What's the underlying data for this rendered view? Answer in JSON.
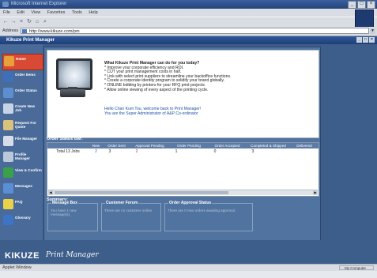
{
  "browser": {
    "title": "Microsoft Internet Explorer",
    "menu": [
      "File",
      "Edit",
      "View",
      "Favorites",
      "Tools",
      "Help"
    ],
    "address_label": "Address",
    "address_value": "http://www.kikuze.com/pm"
  },
  "app": {
    "title": "Kikuze Print Manager",
    "nav": [
      {
        "label": "Home",
        "icon": "home-icon",
        "color": "#e8a13a"
      },
      {
        "label": "Order Items",
        "icon": "order-items-icon",
        "color": "#3f6fb8"
      },
      {
        "label": "Order Status",
        "icon": "order-status-icon",
        "color": "#5c8fd0"
      },
      {
        "label": "Create New Job",
        "icon": "create-job-icon",
        "color": "#c6d4e6"
      },
      {
        "label": "Request For Quote",
        "icon": "quote-icon",
        "color": "#d9c27a"
      },
      {
        "label": "File Manager",
        "icon": "file-manager-icon",
        "color": "#d6dde8"
      },
      {
        "label": "Profile Manager",
        "icon": "profile-manager-icon",
        "color": "#b9c8db"
      },
      {
        "label": "View & Confirm",
        "icon": "view-confirm-icon",
        "color": "#3aa04a"
      },
      {
        "label": "Messages",
        "icon": "messages-icon",
        "color": "#5a8fd8"
      },
      {
        "label": "FAQ",
        "icon": "faq-icon",
        "color": "#e9d24a"
      },
      {
        "label": "Glossary",
        "icon": "glossary-icon",
        "color": "#3c74c6"
      }
    ],
    "welcome": {
      "question": "What Kikuze Print Manager can do for you today?",
      "bullets": [
        "* Improve your corporate efficiency and ROI.",
        "* CUT your print management costs in half.",
        "* Link with select print suppliers to streamline your backoffice functions.",
        "* Create a corporate identity program to solidify your brand globally.",
        "* ONLINE bidding by printers for your RFQ print projects.",
        "* Allow online viewing of every aspect of the printing cycle."
      ],
      "hello": "Hello Chan Kum Tou, welcome back to Print Manager!",
      "role": "You are the Super Administrator of A&P Co-ordinator"
    },
    "order_status": {
      "label": "Order Status Bar:",
      "headers": [
        "",
        "New",
        "Order Sent",
        "Approval Pending",
        "Order Pending",
        "Order Accepted",
        "Completed & Shipped",
        "Delivered"
      ],
      "row": [
        "Total 13 Jobs",
        "2",
        "3",
        "2",
        "1",
        "0",
        "3",
        ""
      ]
    },
    "summary": {
      "label": "Summary:",
      "boxes": [
        {
          "title": "Message Box",
          "text": "You have 1 new message(s)."
        },
        {
          "title": "Customer Forum",
          "text": "There are no customer online."
        },
        {
          "title": "Order Approval Status",
          "text": "There are 0 new orders awaiting approval."
        }
      ]
    },
    "logo_text": "KIKUZE",
    "logo_script": "Print Manager"
  },
  "status_bar": {
    "left": "Applet Window",
    "zone": "My Computer"
  }
}
